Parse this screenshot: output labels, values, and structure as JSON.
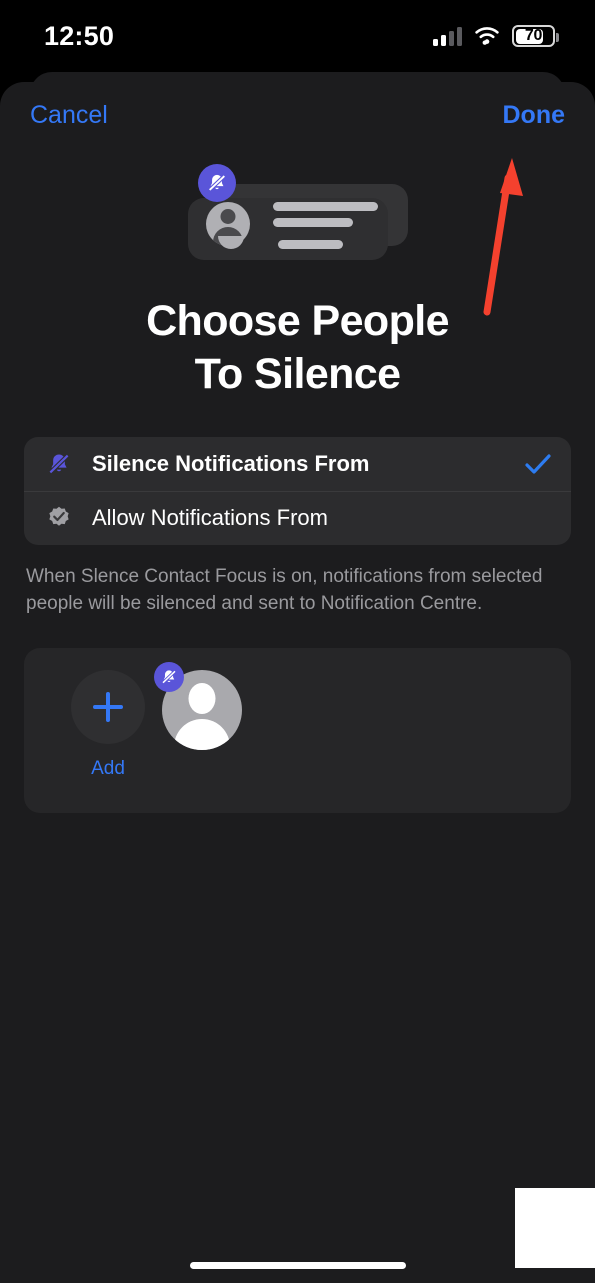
{
  "status_bar": {
    "time": "12:50",
    "battery_level": "70",
    "battery_percent": 70,
    "cellular_icon": "cellular-signal-icon",
    "wifi_icon": "wifi-icon",
    "battery_icon": "battery-icon"
  },
  "navbar": {
    "cancel_label": "Cancel",
    "done_label": "Done"
  },
  "hero": {
    "badge_icon": "bell-slash-icon",
    "avatar_icon": "person-icon",
    "card_icon": "notification-card-icon"
  },
  "page_title_line1": "Choose People",
  "page_title_line2": "To Silence",
  "options": [
    {
      "label": "Silence Notifications From",
      "icon": "bell-slash-icon",
      "selected": true,
      "check_icon": "checkmark-icon"
    },
    {
      "label": "Allow Notifications From",
      "icon": "checkmark-seal-icon",
      "selected": false,
      "check_icon": ""
    }
  ],
  "footer_note": "When Slence Contact Focus is on, notifications from selected people will be silenced and sent to Notification Centre.",
  "people": {
    "add_label": "Add",
    "add_icon": "plus-icon",
    "contacts": [
      {
        "avatar_icon": "person-placeholder-icon",
        "badge_icon": "bell-slash-icon"
      }
    ]
  },
  "annotation": {
    "arrow_icon": "arrow-up-right-icon",
    "color": "#f4412e",
    "points_to": "Done"
  },
  "colors": {
    "accent_blue": "#3478f6",
    "badge_purple": "#5a55d9",
    "sheet_background": "#1c1c1e",
    "group_background": "#2c2c2e",
    "secondary_text": "#9a9a9e",
    "annotation_red": "#f4412e"
  },
  "home_indicator": "home-indicator"
}
